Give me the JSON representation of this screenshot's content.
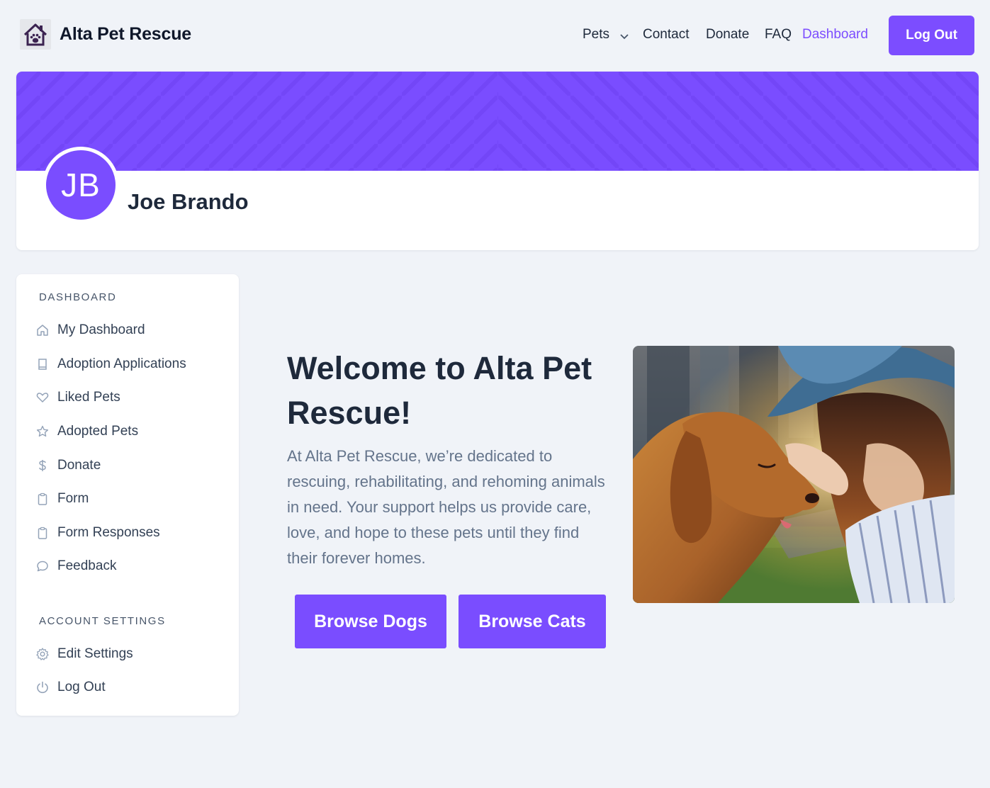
{
  "brand": {
    "name": "Alta Pet Rescue",
    "logo_icon": "house-paw-icon"
  },
  "nav": {
    "pets": "Pets",
    "contact": "Contact",
    "donate": "Donate",
    "faq": "FAQ",
    "dashboard": "Dashboard",
    "logout": "Log Out",
    "active_color": "#7c4dff"
  },
  "profile": {
    "initials": "JB",
    "name": "Joe Brando",
    "banner_color": "#7a4dff"
  },
  "sidebar": {
    "dashboard_heading": "DASHBOARD",
    "items": [
      {
        "label": "My Dashboard",
        "icon": "home-icon"
      },
      {
        "label": "Adoption Applications",
        "icon": "book-icon"
      },
      {
        "label": "Liked Pets",
        "icon": "heart-icon"
      },
      {
        "label": "Adopted Pets",
        "icon": "star-icon"
      },
      {
        "label": "Donate",
        "icon": "dollar-icon"
      },
      {
        "label": "Form",
        "icon": "clipboard-icon"
      },
      {
        "label": "Form Responses",
        "icon": "clipboard-icon"
      },
      {
        "label": "Feedback",
        "icon": "chat-bubble-icon"
      }
    ],
    "settings_heading": "ACCOUNT SETTINGS",
    "settings_items": [
      {
        "label": "Edit Settings",
        "icon": "gear-icon"
      },
      {
        "label": "Log Out",
        "icon": "power-icon"
      }
    ]
  },
  "hero": {
    "title": "Welcome to Alta Pet Rescue!",
    "description": "At Alta Pet Rescue, we’re dedicated to rescuing, rehabilitating, and rehoming animals in need. Your support helps us provide care, love, and hope to these pets until they find their forever homes.",
    "browse_dogs": "Browse Dogs",
    "browse_cats": "Browse Cats"
  },
  "accent_color": "#7a4dff"
}
